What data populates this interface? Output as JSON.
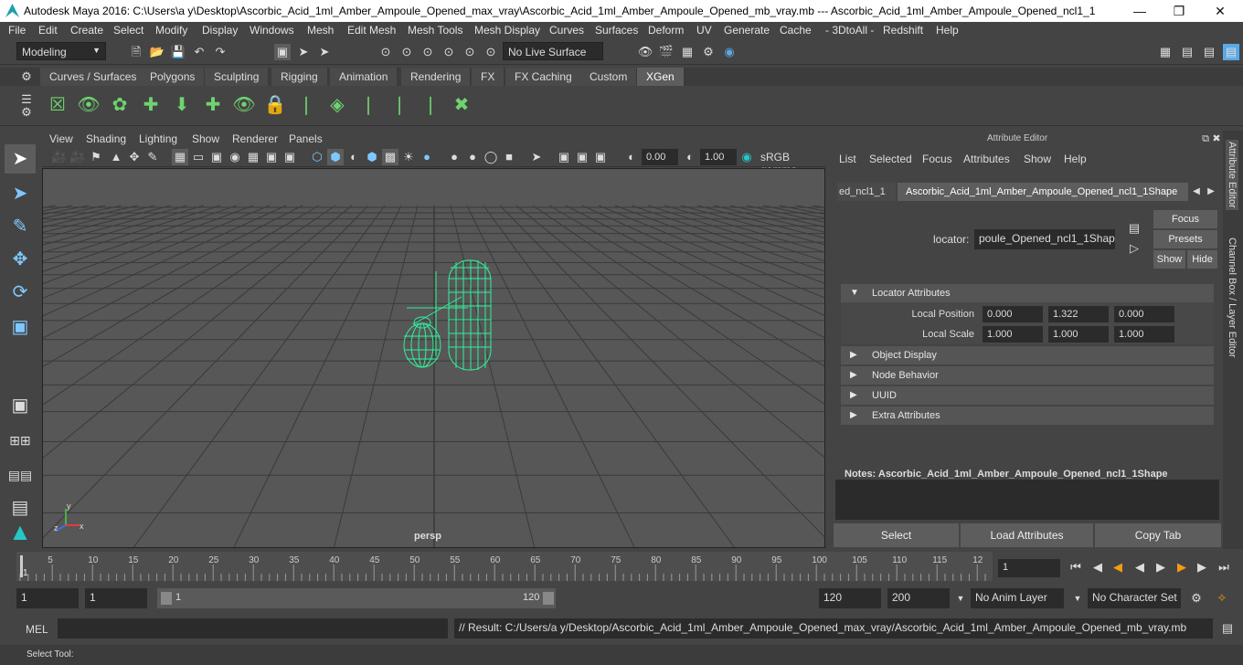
{
  "window": {
    "title": "Autodesk Maya 2016: C:\\Users\\a y\\Desktop\\Ascorbic_Acid_1ml_Amber_Ampoule_Opened_max_vray\\Ascorbic_Acid_1ml_Amber_Ampoule_Opened_mb_vray.mb  ---  Ascorbic_Acid_1ml_Amber_Ampoule_Opened_ncl1_1",
    "minimize": "—",
    "maximize": "❐",
    "close": "✕"
  },
  "menubar": [
    "File",
    "Edit",
    "Create",
    "Select",
    "Modify",
    "Display",
    "Windows",
    "Mesh",
    "Edit Mesh",
    "Mesh Tools",
    "Mesh Display",
    "Curves",
    "Surfaces",
    "Deform",
    "UV",
    "Generate",
    "Cache",
    "- 3DtoAll -",
    "Redshift",
    "Help"
  ],
  "status": {
    "mode": "Modeling",
    "live_surface": "No Live Surface"
  },
  "shelf_tabs": [
    "Curves / Surfaces",
    "Polygons",
    "Sculpting",
    "Rigging",
    "Animation",
    "Rendering",
    "FX",
    "FX Caching",
    "Custom",
    "XGen"
  ],
  "active_shelf_tab": "XGen",
  "panel_menu": [
    "View",
    "Shading",
    "Lighting",
    "Show",
    "Renderer",
    "Panels"
  ],
  "panel_tools": {
    "exposure": "0.00",
    "gamma": "1.00",
    "colorspace": "sRGB gamma"
  },
  "viewport": {
    "camera": "persp"
  },
  "attribute_editor": {
    "title": "Attribute Editor",
    "menu": [
      "List",
      "Selected",
      "Focus",
      "Attributes",
      "Show",
      "Help"
    ],
    "tabs": [
      "ed_ncl1_1",
      "Ascorbic_Acid_1ml_Amber_Ampoule_Opened_ncl1_1Shape"
    ],
    "locator_label": "locator:",
    "locator_value": "poule_Opened_ncl1_1Shape",
    "buttons": {
      "focus": "Focus",
      "presets": "Presets",
      "show": "Show",
      "hide": "Hide"
    },
    "sections": {
      "locator_attributes": "Locator Attributes",
      "object_display": "Object Display",
      "node_behavior": "Node Behavior",
      "uuid": "UUID",
      "extra_attributes": "Extra Attributes"
    },
    "local_position": {
      "label": "Local Position",
      "x": "0.000",
      "y": "1.322",
      "z": "0.000"
    },
    "local_scale": {
      "label": "Local Scale",
      "x": "1.000",
      "y": "1.000",
      "z": "1.000"
    },
    "notes_label": "Notes:  Ascorbic_Acid_1ml_Amber_Ampoule_Opened_ncl1_1Shape",
    "bottom_buttons": {
      "select": "Select",
      "load": "Load Attributes",
      "copy": "Copy Tab"
    }
  },
  "side_tabs": {
    "attribute_editor": "Attribute Editor",
    "channel_box": "Channel Box / Layer Editor"
  },
  "timeline": {
    "ticks": [
      "5",
      "10",
      "15",
      "20",
      "25",
      "30",
      "35",
      "40",
      "45",
      "50",
      "55",
      "60",
      "65",
      "70",
      "75",
      "80",
      "85",
      "90",
      "95",
      "100",
      "105",
      "110",
      "115",
      "12"
    ],
    "start_marker": "1",
    "current_frame": "1"
  },
  "range": {
    "start": "1",
    "playback_start": "1",
    "slider_start": "1",
    "slider_end": "120",
    "playback_end": "120",
    "end": "200",
    "anim_layer": "No Anim Layer",
    "character_set": "No Character Set"
  },
  "cmdline": {
    "label": "MEL",
    "result": "// Result: C:/Users/a y/Desktop/Ascorbic_Acid_1ml_Amber_Ampoule_Opened_max_vray/Ascorbic_Acid_1ml_Amber_Ampoule_Opened_mb_vray.mb"
  },
  "helpline": "Select Tool:",
  "colors": {
    "wire": "#2ef29a",
    "active_tab": "#5d5d5d",
    "accent": "#5aa9e6"
  }
}
